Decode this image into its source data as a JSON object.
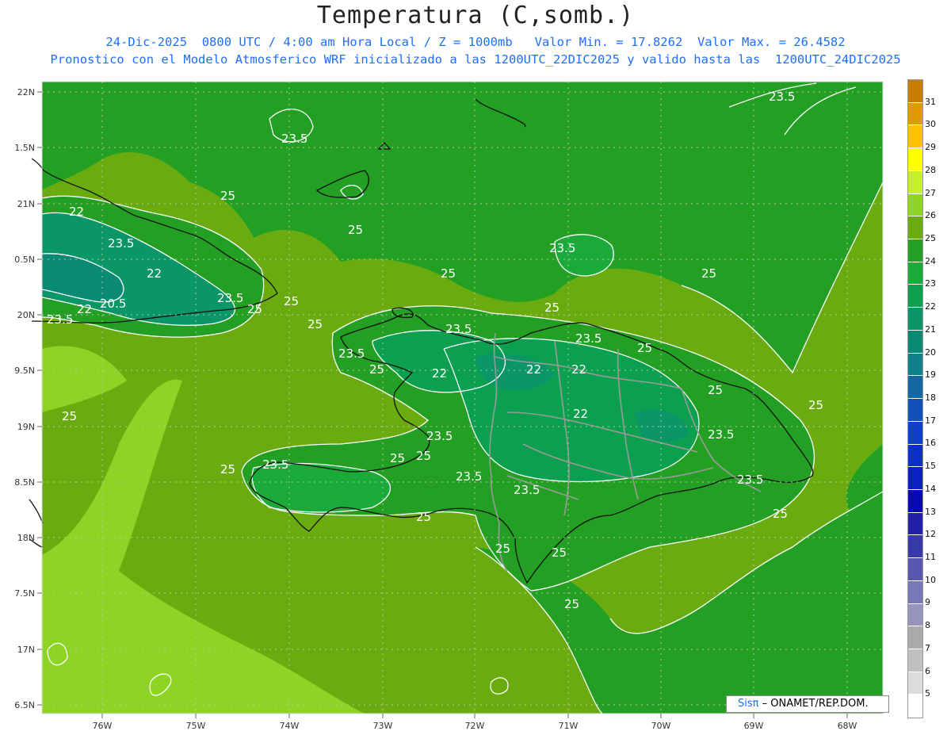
{
  "title": "Temperatura (C,somb.)",
  "subtitle1": "24-Dic-2025  0800 UTC / 4:00 am Hora Local / Z = 1000mb   Valor Min. = 17.8262  Valor Max. = 26.4582",
  "subtitle2": "Pronostico con el Modelo Atmosferico WRF inicializado a las 1200UTC_22DIC2025 y valido hasta las  1200UTC_24DIC2025",
  "credit": {
    "sis": "Sis",
    "pi": "π",
    "rest": " – ONAMET/REP.DOM."
  },
  "lat_labels": [
    "22N",
    "1.5N",
    "21N",
    "0.5N",
    "20N",
    "9.5N",
    "19N",
    "8.5N",
    "18N",
    "7.5N",
    "17N",
    "6.5N"
  ],
  "lon_labels": [
    "76W",
    "75W",
    "74W",
    "73W",
    "72W",
    "71W",
    "70W",
    "69W",
    "68W"
  ],
  "legend": {
    "labels": [
      "31",
      "30",
      "29",
      "28",
      "27",
      "26",
      "25",
      "24",
      "23",
      "22",
      "21",
      "20",
      "19",
      "18",
      "17",
      "16",
      "15",
      "14",
      "13",
      "12",
      "11",
      "10",
      "9",
      "8",
      "7",
      "6",
      "5"
    ],
    "colors": [
      "#c87d00",
      "#e09a00",
      "#ffc000",
      "#ffff00",
      "#c8f028",
      "#8ed424",
      "#6aac10",
      "#23a023",
      "#1aaa3a",
      "#0aa050",
      "#0a9666",
      "#0a8a74",
      "#10808a",
      "#1268a0",
      "#1050b8",
      "#1040c8",
      "#0a30c8",
      "#0a20c0",
      "#0808b4",
      "#2020a8",
      "#3838a8",
      "#5858b0",
      "#7878b8",
      "#9494bc",
      "#aaaaaa",
      "#c0c0c0",
      "#dcdcdc",
      "#ffffff"
    ]
  },
  "contour_labels": [
    {
      "text": "23.5"
    },
    {
      "text": "23.5"
    },
    {
      "text": "25"
    },
    {
      "text": "22"
    },
    {
      "text": "23.5"
    },
    {
      "text": "25"
    },
    {
      "text": "22"
    },
    {
      "text": "20.5"
    },
    {
      "text": "22"
    },
    {
      "text": "23.5"
    },
    {
      "text": "23.5"
    },
    {
      "text": "25"
    },
    {
      "text": "25"
    },
    {
      "text": "25"
    },
    {
      "text": "23.5"
    },
    {
      "text": "25"
    },
    {
      "text": "25"
    },
    {
      "text": "25"
    },
    {
      "text": "23.5"
    },
    {
      "text": "25"
    },
    {
      "text": "23.5"
    },
    {
      "text": "25"
    },
    {
      "text": "22"
    },
    {
      "text": "22"
    },
    {
      "text": "22"
    },
    {
      "text": "25"
    },
    {
      "text": "25"
    },
    {
      "text": "22"
    },
    {
      "text": "25"
    },
    {
      "text": "23.5"
    },
    {
      "text": "23.5"
    },
    {
      "text": "25"
    },
    {
      "text": "25"
    },
    {
      "text": "23.5"
    },
    {
      "text": "25"
    },
    {
      "text": "23.5"
    },
    {
      "text": "23.5"
    },
    {
      "text": "23.5"
    },
    {
      "text": "23.5"
    },
    {
      "text": "25"
    },
    {
      "text": "25"
    },
    {
      "text": "25"
    },
    {
      "text": "25"
    },
    {
      "text": "25"
    }
  ]
}
